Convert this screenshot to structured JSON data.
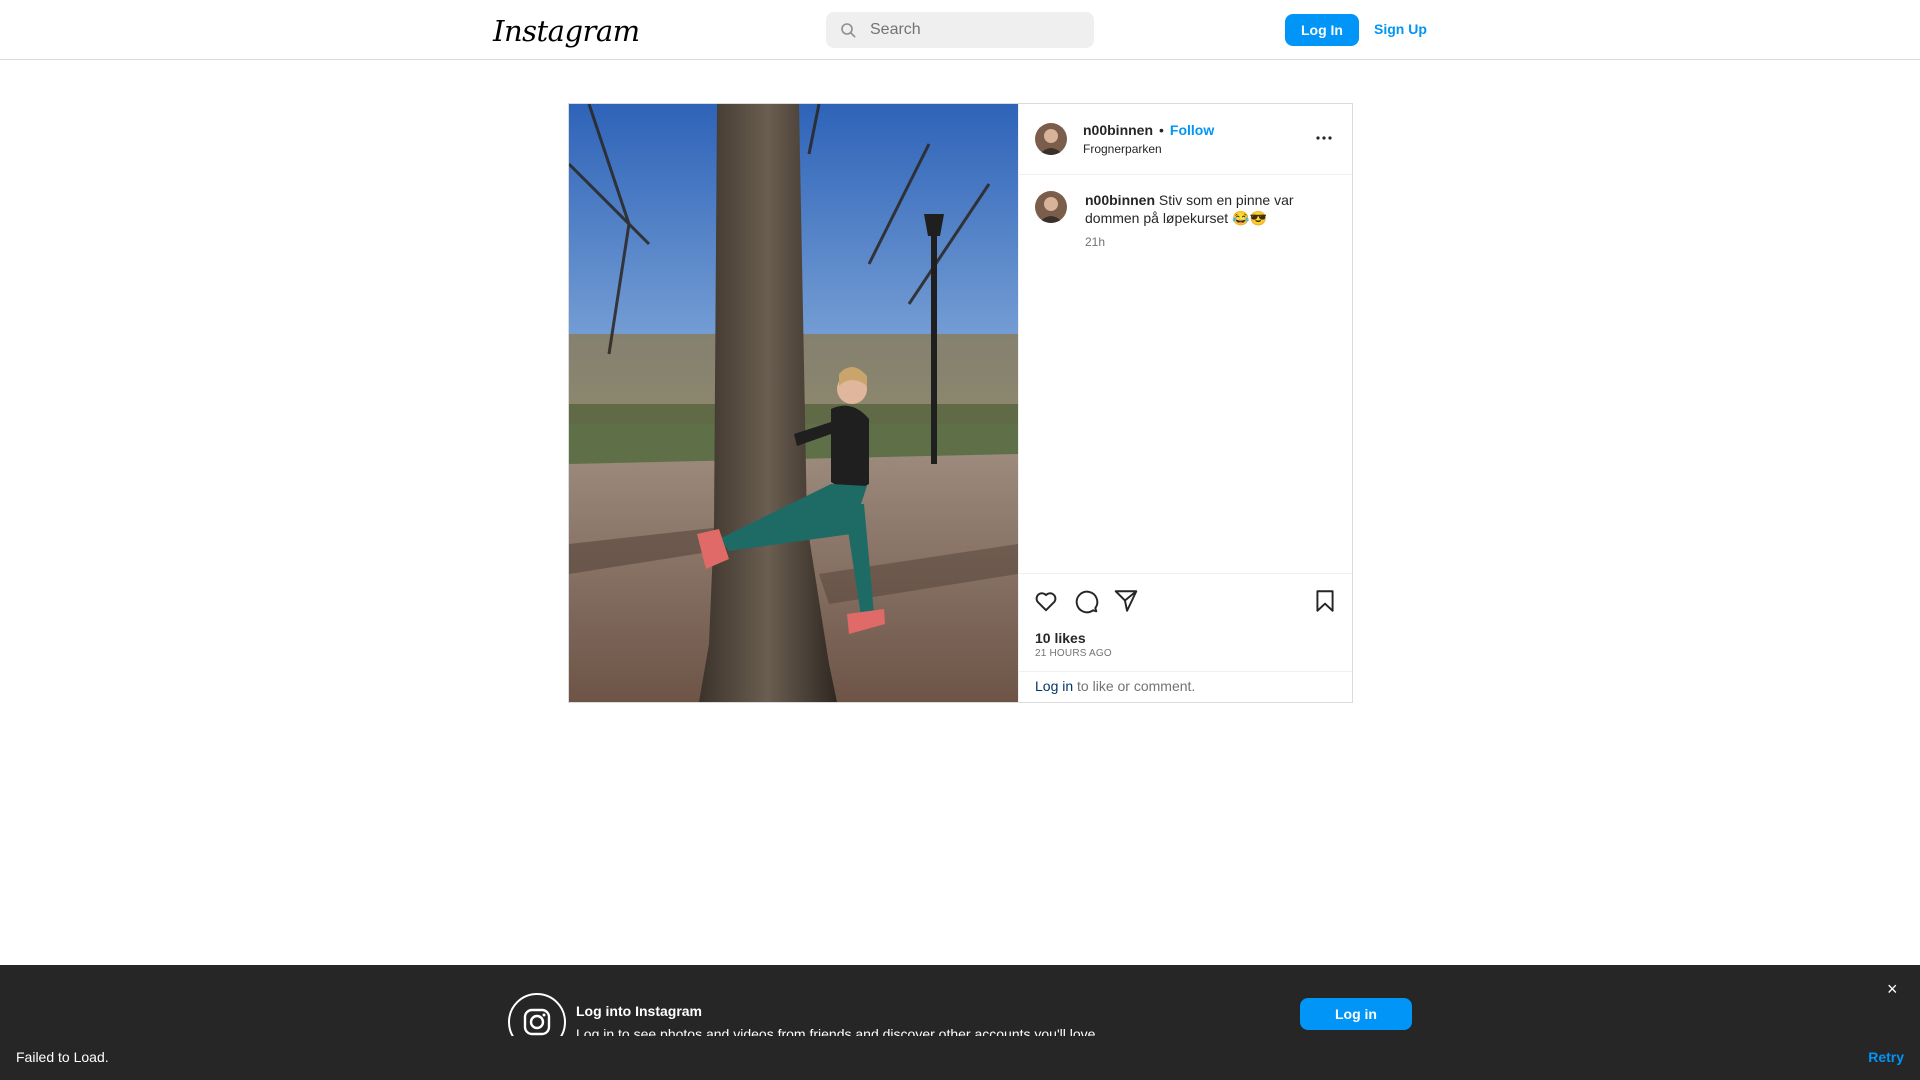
{
  "header": {
    "logo_text": "Instagram",
    "search_placeholder": "Search",
    "login_label": "Log In",
    "signup_label": "Sign Up"
  },
  "post": {
    "username": "n00binnen",
    "dot": "•",
    "follow_label": "Follow",
    "location": "Frognerparken",
    "caption": "Stiv som en pinne var dommen på løpekurset 😂😎",
    "caption_time": "21h",
    "likes_text": "10 likes",
    "time_ago": "21 HOURS AGO",
    "login_link": "Log in",
    "login_suffix": " to like or comment."
  },
  "banner": {
    "title": "Log into Instagram",
    "subtitle": "Log in to see photos and videos from friends and discover other accounts you'll love.",
    "login_label": "Log in",
    "close_label": "×"
  },
  "toast": {
    "message": "Failed to Load.",
    "retry_label": "Retry"
  },
  "colors": {
    "accent": "#0095f6",
    "banner_bg": "#262626"
  }
}
